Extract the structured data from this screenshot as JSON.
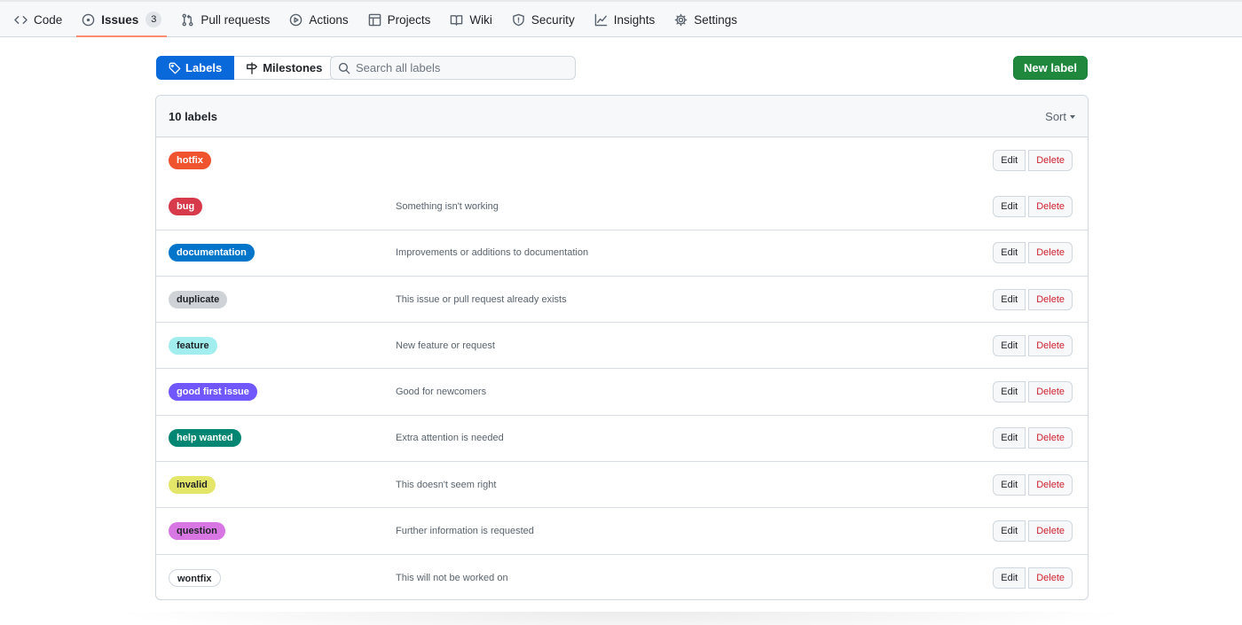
{
  "nav": {
    "tabs": [
      {
        "label": "Code",
        "icon": "code-icon"
      },
      {
        "label": "Issues",
        "icon": "issue-opened-icon",
        "counter": "3"
      },
      {
        "label": "Pull requests",
        "icon": "pull-request-icon"
      },
      {
        "label": "Actions",
        "icon": "play-icon"
      },
      {
        "label": "Projects",
        "icon": "table-icon"
      },
      {
        "label": "Wiki",
        "icon": "book-icon"
      },
      {
        "label": "Security",
        "icon": "shield-icon"
      },
      {
        "label": "Insights",
        "icon": "graph-icon"
      },
      {
        "label": "Settings",
        "icon": "gear-icon"
      }
    ],
    "selected": "Issues"
  },
  "subnav": {
    "labels_label": "Labels",
    "milestones_label": "Milestones"
  },
  "search": {
    "placeholder": "Search all labels",
    "value": ""
  },
  "new_label_button": "New label",
  "list": {
    "count_label": "10 labels",
    "sort_label": "Sort",
    "edit_label": "Edit",
    "delete_label": "Delete",
    "labels": [
      {
        "name": "hotfix",
        "description": "",
        "bg": "#f0542f",
        "fg": "#ffffff"
      },
      {
        "name": "bug",
        "description": "Something isn't working",
        "bg": "#d73a4a",
        "fg": "#ffffff"
      },
      {
        "name": "documentation",
        "description": "Improvements or additions to documentation",
        "bg": "#0075ca",
        "fg": "#ffffff"
      },
      {
        "name": "duplicate",
        "description": "This issue or pull request already exists",
        "bg": "#cfd3d7",
        "fg": "#1f2328"
      },
      {
        "name": "feature",
        "description": "New feature or request",
        "bg": "#a2eeef",
        "fg": "#1f2328"
      },
      {
        "name": "good first issue",
        "description": "Good for newcomers",
        "bg": "#7057ff",
        "fg": "#ffffff"
      },
      {
        "name": "help wanted",
        "description": "Extra attention is needed",
        "bg": "#008672",
        "fg": "#ffffff"
      },
      {
        "name": "invalid",
        "description": "This doesn't seem right",
        "bg": "#e4e669",
        "fg": "#1f2328"
      },
      {
        "name": "question",
        "description": "Further information is requested",
        "bg": "#d876e3",
        "fg": "#1f2328"
      },
      {
        "name": "wontfix",
        "description": "This will not be worked on",
        "bg": "#ffffff",
        "fg": "#1f2328"
      }
    ]
  }
}
